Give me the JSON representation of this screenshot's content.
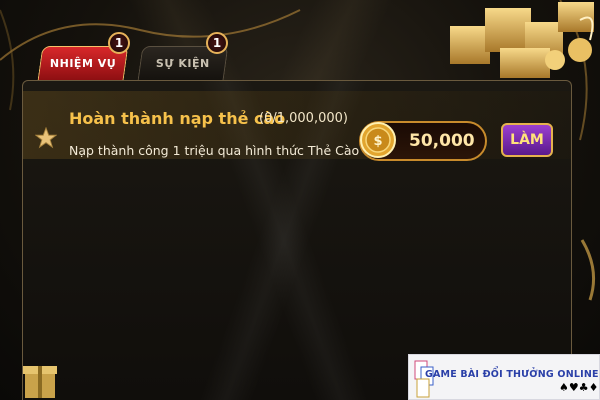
{
  "tabs": [
    {
      "label": "NHIỆM VỤ",
      "badge": "1",
      "active": true
    },
    {
      "label": "SỰ KIỆN",
      "badge": "1",
      "active": false
    }
  ],
  "mission": {
    "title": "Hoàn thành nạp thẻ cào",
    "progress": "(0/1,000,000)",
    "description": "Nạp thành công 1 triệu qua hình thức Thẻ Cào",
    "reward": "50,000",
    "action_label": "LÀM"
  },
  "icons": [
    "star-icon",
    "coin-icon",
    "gift-boxes-icon",
    "playing-card-suits-icon"
  ],
  "watermark": {
    "text": "GAME BÀI ĐỔI THƯỞNG ONLINE",
    "suits": "♠♥♣♦"
  },
  "colors": {
    "accent_gold": "#f6c14b",
    "tab_active": "#c41e22",
    "button_purple": "#7a2cb0"
  }
}
